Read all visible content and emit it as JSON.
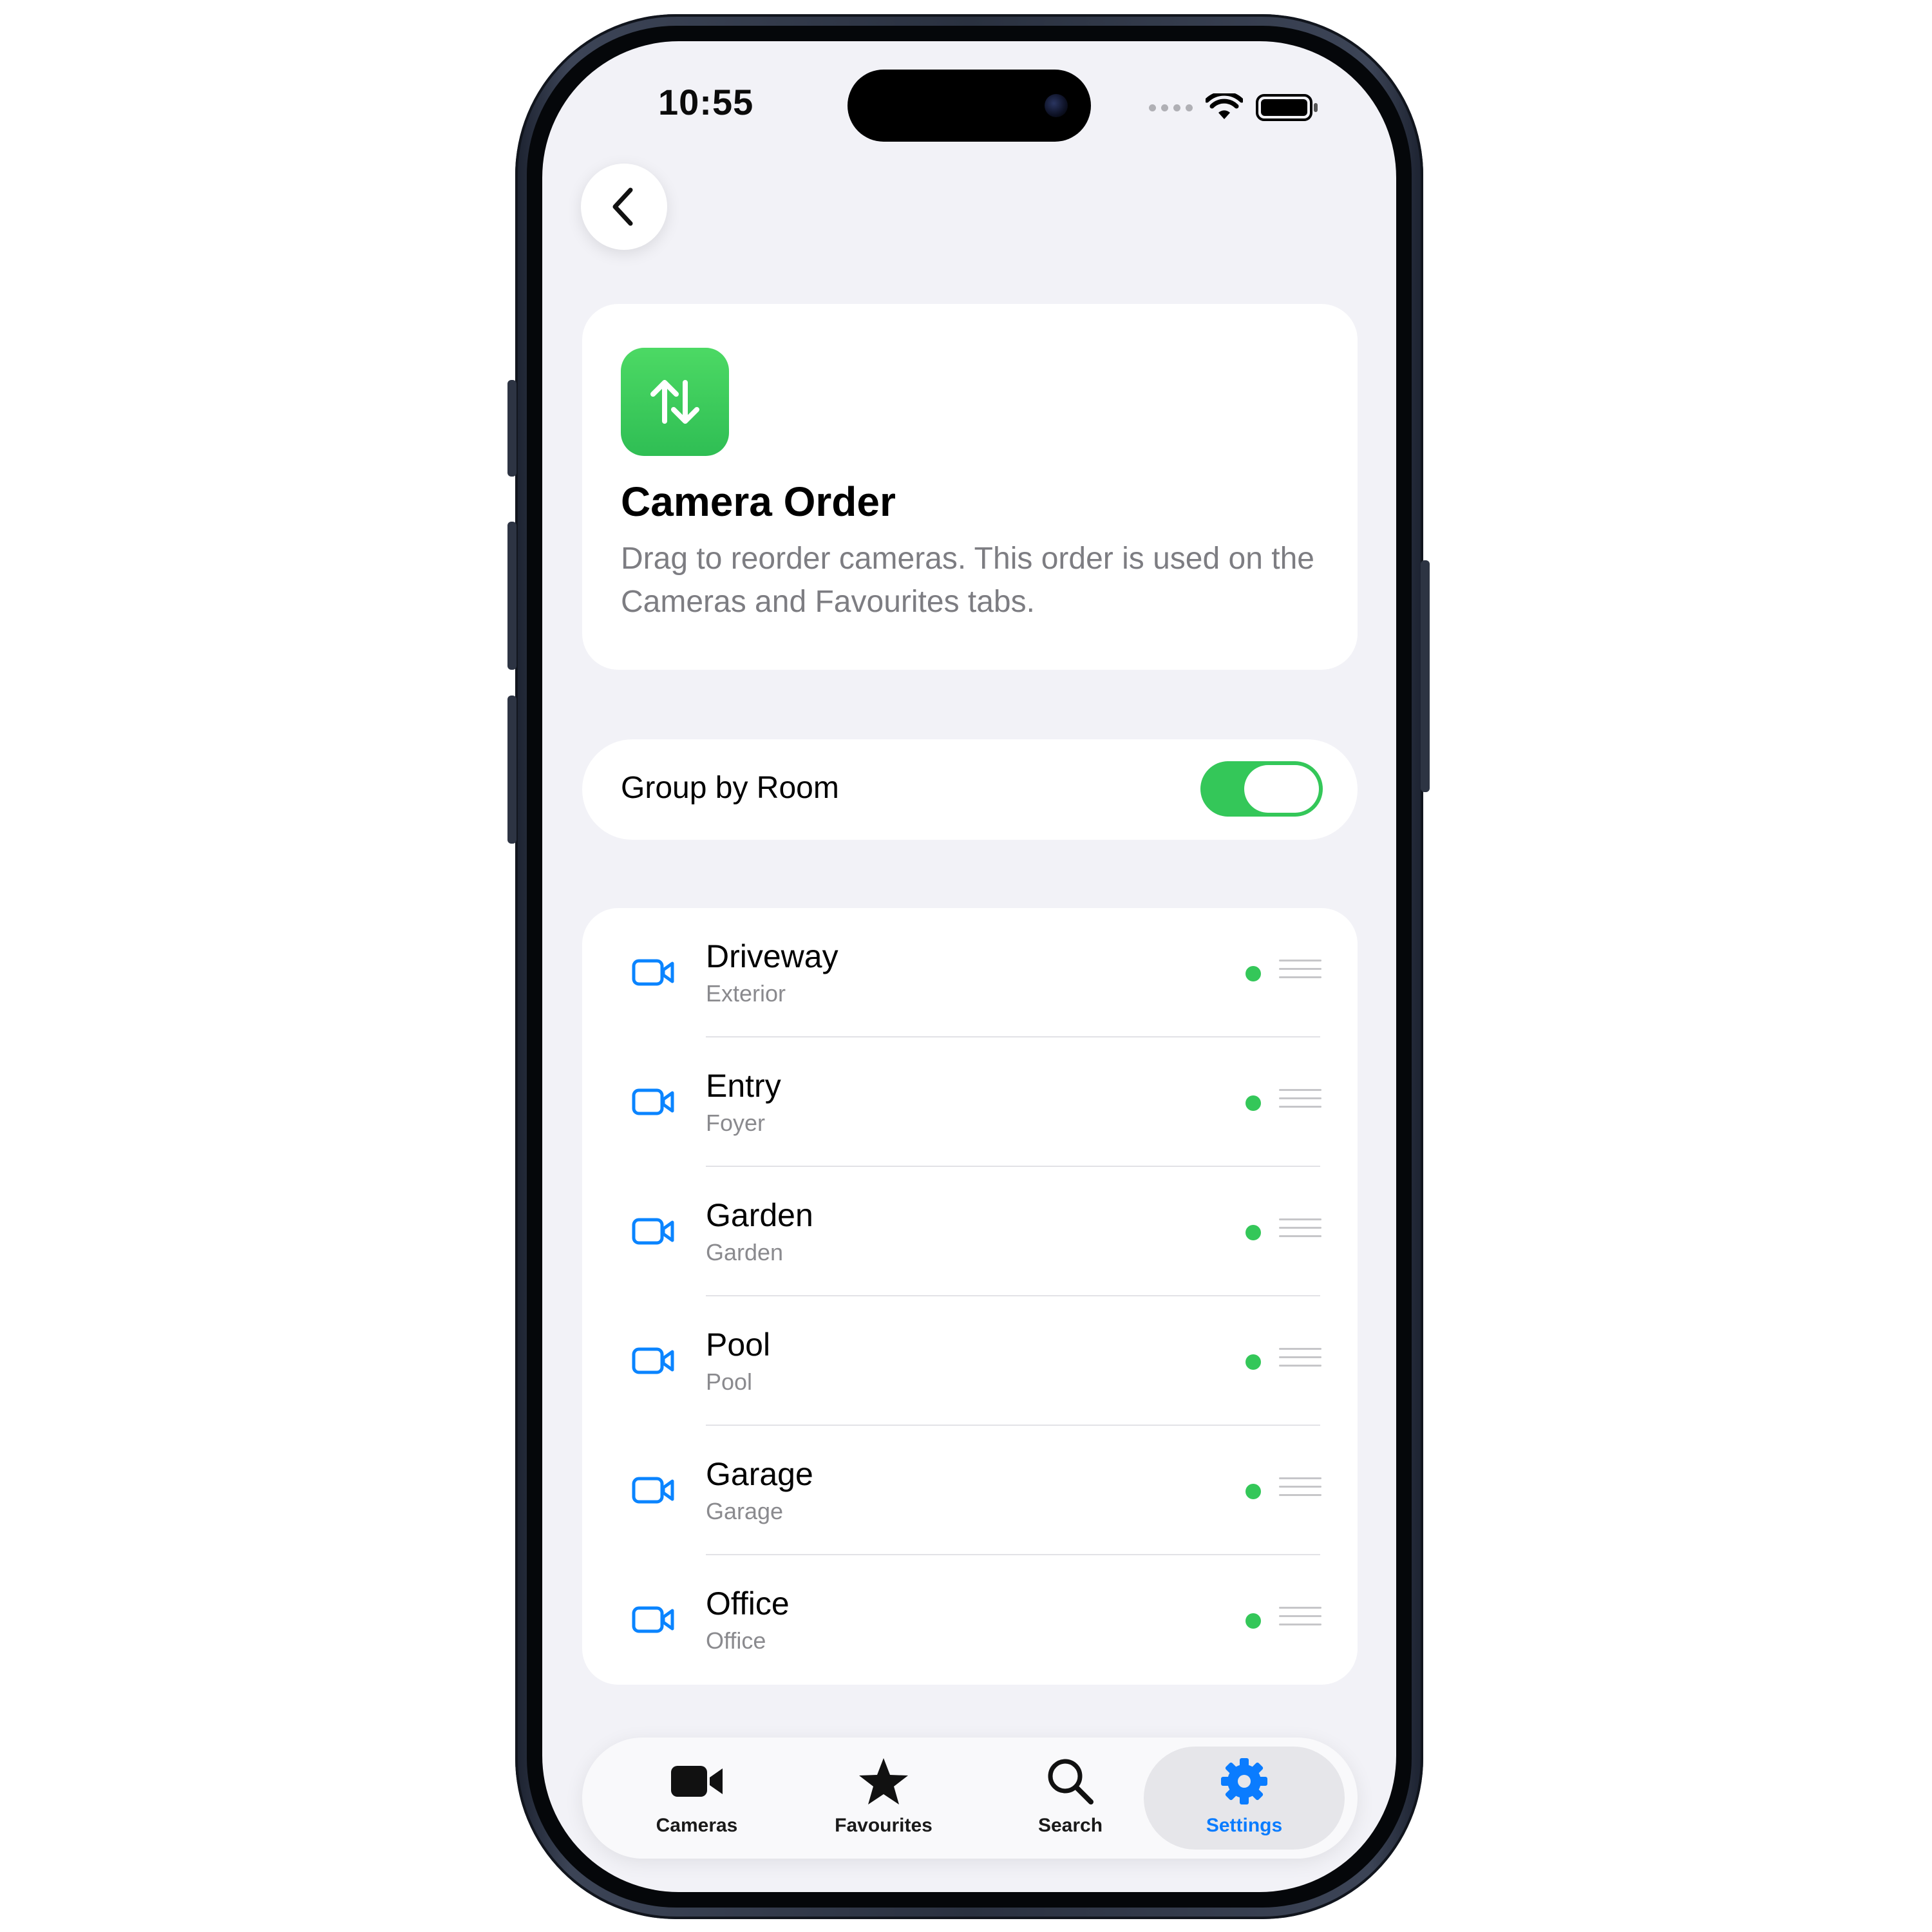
{
  "status_bar": {
    "time": "10:55"
  },
  "navigation": {
    "back_icon": "chevron-left-icon"
  },
  "header": {
    "icon": "arrows-up-down-icon",
    "icon_color": "#34c759",
    "title": "Camera Order",
    "description": "Drag to reorder cameras. This order is used on the Cameras and Favourites tabs."
  },
  "group_by_room": {
    "label": "Group by Room",
    "enabled": true,
    "color": "#34c759"
  },
  "cameras": [
    {
      "name": "Driveway",
      "room": "Exterior",
      "status": "online"
    },
    {
      "name": "Entry",
      "room": "Foyer",
      "status": "online"
    },
    {
      "name": "Garden",
      "room": "Garden",
      "status": "online"
    },
    {
      "name": "Pool",
      "room": "Pool",
      "status": "online"
    },
    {
      "name": "Garage",
      "room": "Garage",
      "status": "online"
    },
    {
      "name": "Office",
      "room": "Office",
      "status": "online"
    }
  ],
  "tab_bar": {
    "active": "Settings",
    "accent_color": "#0a7cff",
    "tabs": [
      {
        "label": "Cameras",
        "icon": "video-camera-icon"
      },
      {
        "label": "Favourites",
        "icon": "star-icon"
      },
      {
        "label": "Search",
        "icon": "magnifying-glass-icon"
      },
      {
        "label": "Settings",
        "icon": "gear-icon"
      }
    ]
  }
}
